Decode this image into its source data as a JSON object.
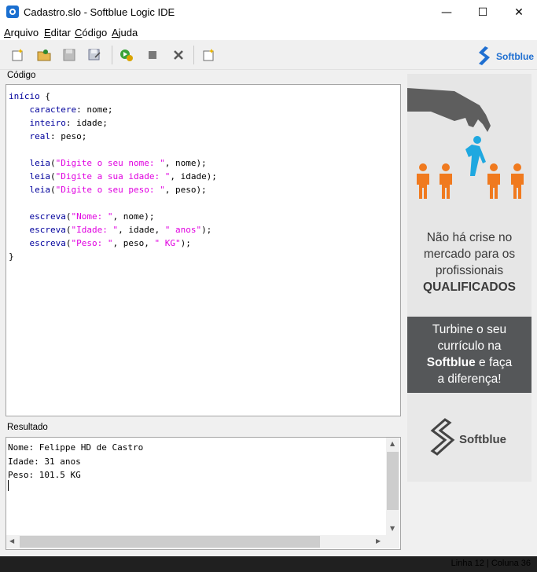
{
  "window": {
    "title": "Cadastro.slo - Softblue Logic IDE",
    "minimize": "—",
    "maximize": "☐",
    "close": "✕"
  },
  "menu": {
    "items": [
      {
        "label_u": "A",
        "label_rest": "rquivo"
      },
      {
        "label_u": "E",
        "label_rest": "ditar"
      },
      {
        "label_u": "C",
        "label_rest": "ódigo"
      },
      {
        "label_u": "A",
        "label_rest": "juda"
      }
    ]
  },
  "toolbar": {
    "icons": [
      "new-file-icon",
      "open-folder-icon",
      "save-icon",
      "save-as-icon",
      "run-icon",
      "stop-icon",
      "clear-icon",
      "export-icon"
    ]
  },
  "brand": {
    "name": "Softblue",
    "accent": "#1f6fd1"
  },
  "code_panel": {
    "label": "Código",
    "lines": [
      [
        {
          "t": "início",
          "c": "kw"
        },
        {
          "t": " {",
          "c": ""
        }
      ],
      [
        {
          "t": "    ",
          "c": ""
        },
        {
          "t": "caractere",
          "c": "kw"
        },
        {
          "t": ": nome;",
          "c": ""
        }
      ],
      [
        {
          "t": "    ",
          "c": ""
        },
        {
          "t": "inteiro",
          "c": "kw"
        },
        {
          "t": ": idade;",
          "c": ""
        }
      ],
      [
        {
          "t": "    ",
          "c": ""
        },
        {
          "t": "real",
          "c": "kw"
        },
        {
          "t": ": peso;",
          "c": ""
        }
      ],
      [],
      [
        {
          "t": "    ",
          "c": ""
        },
        {
          "t": "leia",
          "c": "kw"
        },
        {
          "t": "(",
          "c": ""
        },
        {
          "t": "\"Digite o seu nome: \"",
          "c": "str"
        },
        {
          "t": ", nome);",
          "c": ""
        }
      ],
      [
        {
          "t": "    ",
          "c": ""
        },
        {
          "t": "leia",
          "c": "kw"
        },
        {
          "t": "(",
          "c": ""
        },
        {
          "t": "\"Digite a sua idade: \"",
          "c": "str"
        },
        {
          "t": ", idade);",
          "c": ""
        }
      ],
      [
        {
          "t": "    ",
          "c": ""
        },
        {
          "t": "leia",
          "c": "kw"
        },
        {
          "t": "(",
          "c": ""
        },
        {
          "t": "\"Digite o seu peso: \"",
          "c": "str"
        },
        {
          "t": ", peso);",
          "c": ""
        }
      ],
      [],
      [
        {
          "t": "    ",
          "c": ""
        },
        {
          "t": "escreva",
          "c": "kw"
        },
        {
          "t": "(",
          "c": ""
        },
        {
          "t": "\"Nome: \"",
          "c": "str"
        },
        {
          "t": ", nome);",
          "c": ""
        }
      ],
      [
        {
          "t": "    ",
          "c": ""
        },
        {
          "t": "escreva",
          "c": "kw"
        },
        {
          "t": "(",
          "c": ""
        },
        {
          "t": "\"Idade: \"",
          "c": "str"
        },
        {
          "t": ", idade, ",
          "c": ""
        },
        {
          "t": "\" anos\"",
          "c": "str"
        },
        {
          "t": ");",
          "c": ""
        }
      ],
      [
        {
          "t": "    ",
          "c": ""
        },
        {
          "t": "escreva",
          "c": "kw"
        },
        {
          "t": "(",
          "c": ""
        },
        {
          "t": "\"Peso: \"",
          "c": "str"
        },
        {
          "t": ", peso, ",
          "c": ""
        },
        {
          "t": "\" KG\"",
          "c": "str"
        },
        {
          "t": ");",
          "c": ""
        }
      ],
      [
        {
          "t": "}",
          "c": ""
        }
      ]
    ]
  },
  "result_panel": {
    "label": "Resultado",
    "lines": [
      "Nome: Felippe HD de Castro",
      "Idade: 31 anos",
      "Peso: 101.5 KG"
    ]
  },
  "ad": {
    "text1_lines": [
      "Não há crise no",
      "mercado para os",
      "profissionais"
    ],
    "text1_bold": "QUALIFICADOS",
    "text2_line1": "Turbine o seu",
    "text2_line2": "currículo na",
    "text2_bold": "Softblue",
    "text2_after": " e faça",
    "text2_line4": "a diferença!",
    "logo_text": "Softblue"
  },
  "status": {
    "text": "Linha 12 | Coluna 36"
  }
}
